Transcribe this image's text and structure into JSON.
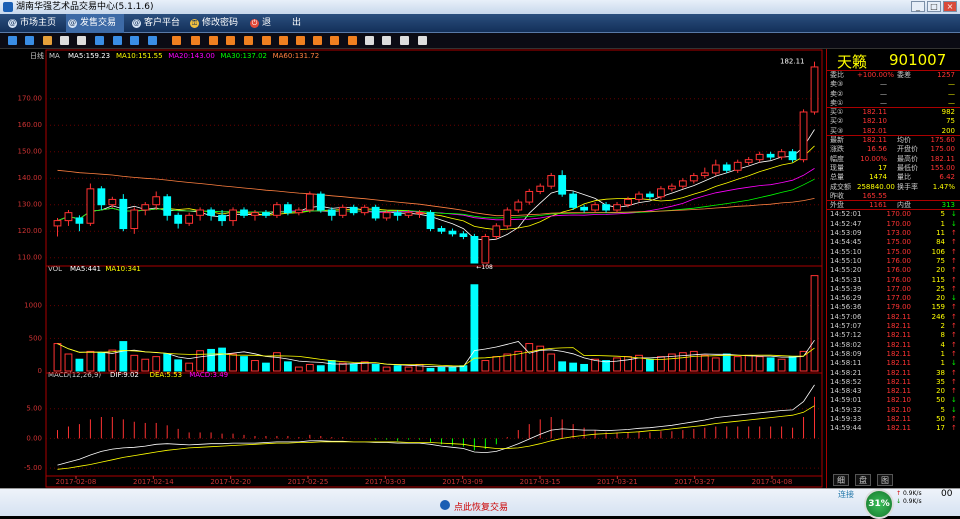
{
  "window": {
    "title": "湖南华强艺术品交易中心(5.1.1.6)",
    "buttons": [
      "_",
      "□",
      "×"
    ]
  },
  "menu": [
    {
      "label": "市场主页",
      "icon": "globe-icon"
    },
    {
      "label": "发售交易",
      "icon": "globe-icon",
      "active": true
    },
    {
      "label": "客户平台",
      "icon": "globe-icon"
    },
    {
      "label": "修改密码",
      "icon": "key-icon"
    },
    {
      "label": "退",
      "icon": "power-icon"
    },
    {
      "label": "出",
      "icon": ""
    }
  ],
  "toolbar_icons": [
    "bar-chart-icon",
    "line-chart-icon",
    "kline-icon",
    "calendar-icon",
    "minute-chart-icon",
    "daily-chart-icon",
    "weekly-chart-icon",
    "monthly-chart-icon",
    "f10-icon",
    "tool1-icon",
    "tool2-icon",
    "tool3-icon",
    "tool4-icon",
    "tool5-icon",
    "tool6-icon",
    "tool7-icon",
    "tool8-icon",
    "tool9-icon",
    "tool10-icon",
    "tool11-icon",
    "zoom-in-icon",
    "zoom-out-icon",
    "draw-icon",
    "settings-icon"
  ],
  "chart_data": {
    "type": "candlestick",
    "main": {
      "label": "日线",
      "ma_label": "MA",
      "ma": [
        {
          "name": "MA5:159.23",
          "color": "#ffffff"
        },
        {
          "name": "MA10:151.55",
          "color": "#ffff00"
        },
        {
          "name": "MA20:143.00",
          "color": "#ff00ff"
        },
        {
          "name": "MA30:137.02",
          "color": "#00ff00"
        },
        {
          "name": "MA60:131.72",
          "color": "#ff8040"
        }
      ],
      "yticks": [
        110,
        120,
        130,
        140,
        150,
        160,
        170
      ],
      "ylim": [
        108,
        185
      ],
      "last": "182.11",
      "low_mark": "108"
    },
    "volume": {
      "label": "VOL",
      "ma": [
        {
          "name": "MA5:441",
          "color": "#ffffff"
        },
        {
          "name": "MA10:341",
          "color": "#ffff00"
        }
      ],
      "yticks": [
        0,
        500,
        1000
      ],
      "ylim": [
        0,
        1500
      ]
    },
    "macd": {
      "label": "MACD(12,26,9)",
      "lines": [
        {
          "name": "DIF:9.02",
          "color": "#ffffff"
        },
        {
          "name": "DEA:5.53",
          "color": "#ffff00"
        },
        {
          "name": "MACD:3.49",
          "color": "#ff00ff"
        }
      ],
      "yticks": [
        -5,
        0,
        5
      ],
      "ylim": [
        -6,
        10
      ]
    },
    "dates": [
      "2017-02-08",
      "2017-02-14",
      "2017-02-20",
      "2017-02-25",
      "2017-03-03",
      "2017-03-09",
      "2017-03-15",
      "2017-03-21",
      "2017-03-27",
      "2017-04-08"
    ],
    "candles": [
      [
        122,
        124,
        118,
        125
      ],
      [
        124,
        127,
        122,
        128
      ],
      [
        125,
        123,
        120,
        126
      ],
      [
        123,
        136,
        122,
        138
      ],
      [
        136,
        130,
        128,
        137
      ],
      [
        130,
        132,
        129,
        133
      ],
      [
        132,
        121,
        120,
        134
      ],
      [
        121,
        128,
        119,
        129
      ],
      [
        128,
        130,
        126,
        131
      ],
      [
        130,
        133,
        128,
        135
      ],
      [
        133,
        126,
        124,
        134
      ],
      [
        126,
        123,
        121,
        127
      ],
      [
        123,
        126,
        122,
        127
      ],
      [
        126,
        128,
        124,
        129
      ],
      [
        128,
        126,
        124,
        129
      ],
      [
        126,
        124,
        122,
        128
      ],
      [
        124,
        128,
        122,
        129
      ],
      [
        128,
        126,
        125,
        129
      ],
      [
        126,
        127,
        124,
        128
      ],
      [
        127,
        126,
        125,
        128
      ],
      [
        126,
        130,
        125,
        131
      ],
      [
        130,
        127,
        126,
        131
      ],
      [
        127,
        128,
        126,
        129
      ],
      [
        128,
        134,
        127,
        135
      ],
      [
        134,
        128,
        127,
        135
      ],
      [
        128,
        126,
        124,
        129
      ],
      [
        126,
        129,
        125,
        130
      ],
      [
        129,
        127,
        126,
        130
      ],
      [
        127,
        129,
        126,
        130
      ],
      [
        129,
        125,
        124,
        130
      ],
      [
        125,
        127,
        124,
        128
      ],
      [
        127,
        126,
        124,
        128
      ],
      [
        126,
        127,
        125,
        128
      ],
      [
        127,
        127,
        125,
        128
      ],
      [
        127,
        121,
        120,
        128
      ],
      [
        121,
        120,
        119,
        122
      ],
      [
        120,
        119,
        118,
        121
      ],
      [
        119,
        118,
        117,
        120
      ],
      [
        118,
        108,
        108,
        119
      ],
      [
        108,
        118,
        108,
        119
      ],
      [
        118,
        122,
        117,
        123
      ],
      [
        122,
        128,
        121,
        129
      ],
      [
        128,
        131,
        127,
        132
      ],
      [
        131,
        135,
        130,
        136
      ],
      [
        135,
        137,
        134,
        138
      ],
      [
        137,
        141,
        136,
        142
      ],
      [
        141,
        134,
        133,
        143
      ],
      [
        134,
        129,
        128,
        135
      ],
      [
        129,
        128,
        127,
        130
      ],
      [
        128,
        130,
        127,
        131
      ],
      [
        130,
        128,
        127,
        131
      ],
      [
        128,
        130,
        127,
        131
      ],
      [
        130,
        132,
        129,
        133
      ],
      [
        132,
        134,
        131,
        135
      ],
      [
        134,
        133,
        132,
        135
      ],
      [
        133,
        136,
        132,
        137
      ],
      [
        136,
        137,
        135,
        138
      ],
      [
        137,
        139,
        136,
        140
      ],
      [
        139,
        141,
        138,
        142
      ],
      [
        141,
        142,
        140,
        144
      ],
      [
        142,
        145,
        141,
        147
      ],
      [
        145,
        143,
        142,
        146
      ],
      [
        143,
        146,
        142,
        147
      ],
      [
        146,
        147,
        145,
        148
      ],
      [
        147,
        149,
        146,
        150
      ],
      [
        149,
        148,
        147,
        150
      ],
      [
        148,
        150,
        147,
        151
      ],
      [
        150,
        147,
        146,
        151
      ],
      [
        147,
        165,
        146,
        166
      ],
      [
        165,
        182,
        164,
        184
      ]
    ],
    "volumes": [
      420,
      260,
      180,
      300,
      280,
      320,
      450,
      240,
      180,
      220,
      260,
      170,
      120,
      310,
      330,
      350,
      260,
      220,
      160,
      120,
      280,
      140,
      60,
      100,
      80,
      160,
      120,
      100,
      140,
      100,
      60,
      80,
      60,
      100,
      40,
      60,
      60,
      80,
      1320,
      160,
      220,
      260,
      300,
      420,
      380,
      260,
      140,
      120,
      100,
      180,
      160,
      200,
      220,
      240,
      180,
      220,
      260,
      280,
      300,
      240,
      200,
      260,
      220,
      240,
      220,
      200,
      180,
      220,
      300,
      1460
    ],
    "dif": [
      -4.5,
      -4.0,
      -3.5,
      -2.8,
      -2.2,
      -1.8,
      -1.6,
      -1.5,
      -1.3,
      -1.0,
      -0.9,
      -1.0,
      -1.1,
      -1.0,
      -0.9,
      -0.9,
      -0.8,
      -0.8,
      -0.8,
      -0.7,
      -0.6,
      -0.6,
      -0.6,
      -0.4,
      -0.4,
      -0.5,
      -0.5,
      -0.6,
      -0.6,
      -0.7,
      -0.7,
      -0.8,
      -0.8,
      -0.8,
      -1.0,
      -1.3,
      -1.5,
      -1.7,
      -2.3,
      -2.4,
      -2.2,
      -1.6,
      -0.9,
      -0.1,
      0.7,
      1.4,
      1.6,
      1.5,
      1.4,
      1.4,
      1.3,
      1.4,
      1.5,
      1.7,
      1.8,
      2.0,
      2.2,
      2.5,
      2.8,
      3.1,
      3.5,
      3.7,
      3.9,
      4.1,
      4.3,
      4.5,
      4.7,
      4.8,
      6.2,
      9.0
    ],
    "dea": [
      -5.2,
      -5.0,
      -4.7,
      -4.4,
      -4.0,
      -3.6,
      -3.2,
      -2.9,
      -2.6,
      -2.3,
      -2.0,
      -1.8,
      -1.6,
      -1.5,
      -1.4,
      -1.3,
      -1.2,
      -1.1,
      -1.0,
      -0.9,
      -0.8,
      -0.8,
      -0.7,
      -0.7,
      -0.6,
      -0.6,
      -0.6,
      -0.6,
      -0.6,
      -0.6,
      -0.6,
      -0.6,
      -0.7,
      -0.7,
      -0.7,
      -0.8,
      -0.9,
      -1.0,
      -1.3,
      -1.5,
      -1.7,
      -1.7,
      -1.6,
      -1.3,
      -0.9,
      -0.4,
      0.0,
      0.3,
      0.5,
      0.7,
      0.8,
      0.9,
      1.0,
      1.1,
      1.3,
      1.4,
      1.6,
      1.8,
      2.0,
      2.2,
      2.5,
      2.7,
      2.9,
      3.1,
      3.3,
      3.5,
      3.7,
      3.9,
      4.4,
      5.5
    ]
  },
  "quote": {
    "name": "天籁",
    "code": "901007",
    "head": [
      {
        "l": "委比",
        "v": "+100.00%",
        "l2": "委差",
        "v2": "1257"
      }
    ],
    "asks": [
      {
        "l": "卖③",
        "p": "—",
        "q": "—"
      },
      {
        "l": "卖②",
        "p": "—",
        "q": "—"
      },
      {
        "l": "卖①",
        "p": "—",
        "q": "—"
      }
    ],
    "bids": [
      {
        "l": "买①",
        "p": "182.11",
        "q": "982"
      },
      {
        "l": "买②",
        "p": "182.10",
        "q": "75"
      },
      {
        "l": "买③",
        "p": "182.01",
        "q": "200"
      }
    ],
    "stats": [
      {
        "l": "最新",
        "v": "182.11",
        "l2": "均价",
        "v2": "175.60"
      },
      {
        "l": "涨跌",
        "v": "16.56",
        "l2": "开盘价",
        "v2": "175.00"
      },
      {
        "l": "幅度",
        "v": "10.00%",
        "l2": "最高价",
        "v2": "182.11"
      },
      {
        "l": "现量",
        "v": "17",
        "l2": "最低价",
        "v2": "155.00"
      },
      {
        "l": "总量",
        "v": "1474",
        "l2": "量比",
        "v2": "6.42"
      },
      {
        "l": "成交额",
        "v": "258840.00",
        "l2": "换手率",
        "v2": "1.47%"
      },
      {
        "l": "昨收",
        "v": "165.55",
        "l2": "",
        "v2": ""
      }
    ],
    "outer": {
      "l": "外盘",
      "v": "1161",
      "l2": "内盘",
      "v2": "313"
    },
    "ticks": [
      [
        "14:52:01",
        "170.00",
        "5",
        "↓"
      ],
      [
        "14:52:47",
        "170.00",
        "1",
        "↓"
      ],
      [
        "14:53:09",
        "173.00",
        "11",
        "↑"
      ],
      [
        "14:54:45",
        "175.00",
        "84",
        "↑"
      ],
      [
        "14:55:10",
        "175.00",
        "106",
        "↑"
      ],
      [
        "14:55:10",
        "176.00",
        "75",
        "↑"
      ],
      [
        "14:55:20",
        "176.00",
        "20",
        "↑"
      ],
      [
        "14:55:31",
        "176.00",
        "115",
        "↑"
      ],
      [
        "14:55:39",
        "177.00",
        "25",
        "↑"
      ],
      [
        "14:56:29",
        "177.00",
        "20",
        "↓"
      ],
      [
        "14:56:36",
        "179.00",
        "159",
        "↑"
      ],
      [
        "14:57:06",
        "182.11",
        "246",
        "↑"
      ],
      [
        "14:57:07",
        "182.11",
        "2",
        "↑"
      ],
      [
        "14:57:12",
        "182.11",
        "8",
        "↑"
      ],
      [
        "14:58:02",
        "182.11",
        "4",
        "↑"
      ],
      [
        "14:58:09",
        "182.11",
        "1",
        "↑"
      ],
      [
        "14:58:11",
        "182.11",
        "1",
        "↓"
      ],
      [
        "14:58:21",
        "182.11",
        "38",
        "↑"
      ],
      [
        "14:58:52",
        "182.11",
        "35",
        "↑"
      ],
      [
        "14:58:43",
        "182.11",
        "20",
        "↑"
      ],
      [
        "14:59:01",
        "182.10",
        "50",
        "↓"
      ],
      [
        "14:59:32",
        "182.10",
        "5",
        "↓"
      ],
      [
        "14:59:33",
        "182.11",
        "50",
        "↑"
      ],
      [
        "14:59:44",
        "182.11",
        "17",
        "↑"
      ]
    ],
    "tabs": [
      "细",
      "盘",
      "图"
    ]
  },
  "status": {
    "restore": "点此恢复交易",
    "connect": "连接",
    "gauge": "31%",
    "net_up": "0.9K/s",
    "net_down": "0.9K/s",
    "trail": "00"
  }
}
